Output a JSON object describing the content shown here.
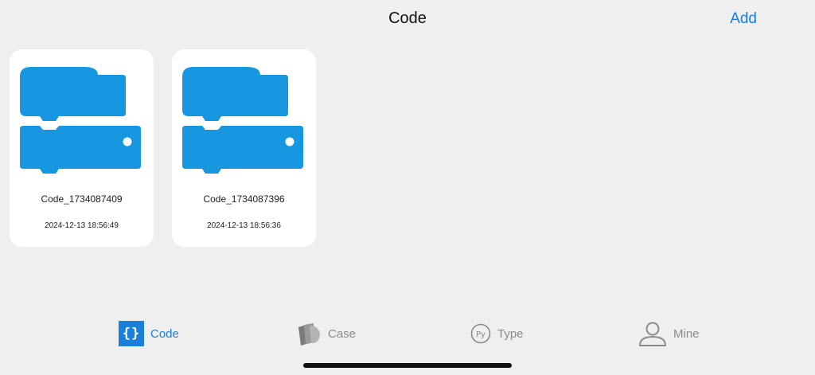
{
  "header": {
    "title": "Code",
    "add_label": "Add"
  },
  "colors": {
    "accent": "#1a7fd9",
    "block": "#1797df",
    "inactive": "#8a8a8a",
    "background": "#efefef"
  },
  "projects": [
    {
      "name": "Code_1734087409",
      "date": "2024-12-13 18:56:49",
      "thumbnail_icon": "code-blocks-icon"
    },
    {
      "name": "Code_1734087396",
      "date": "2024-12-13 18:56:36",
      "thumbnail_icon": "code-blocks-icon"
    }
  ],
  "tabbar": {
    "items": [
      {
        "label": "Code",
        "icon": "code-braces-icon",
        "active": true
      },
      {
        "label": "Case",
        "icon": "cards-icon",
        "active": false
      },
      {
        "label": "Type",
        "icon": "python-icon",
        "active": false
      },
      {
        "label": "Mine",
        "icon": "person-icon",
        "active": false
      }
    ]
  }
}
